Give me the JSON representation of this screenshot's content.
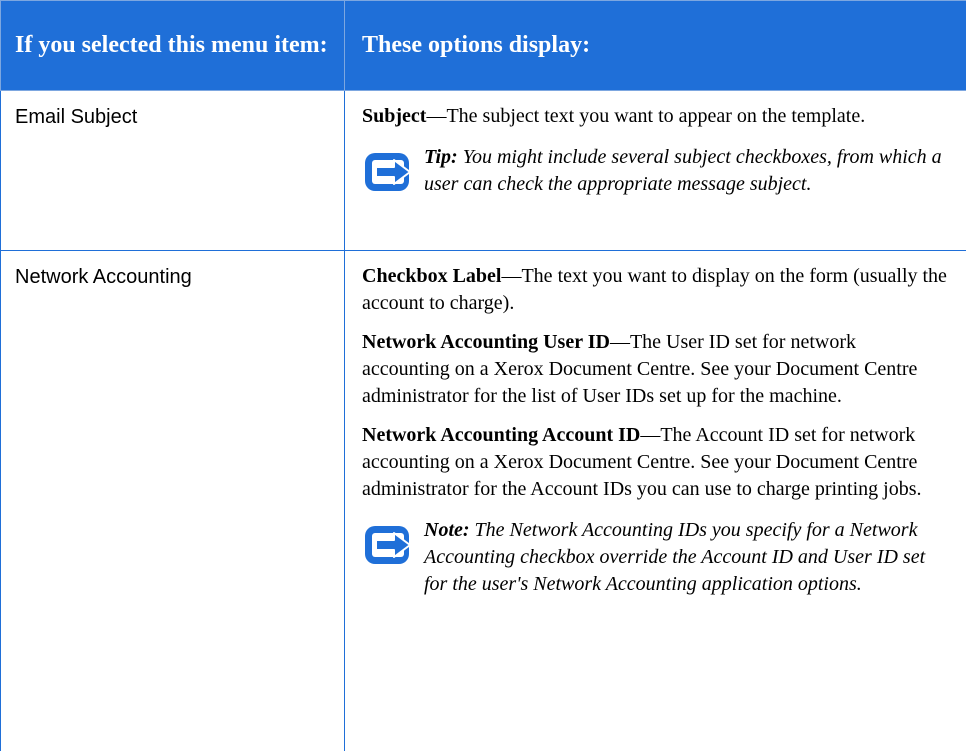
{
  "table": {
    "headers": [
      "If you selected this menu item:",
      "These options display:"
    ],
    "rows": [
      {
        "item": "Email Subject",
        "options": [
          {
            "term": "Subject",
            "text": "—The subject text you want to appear on the template."
          }
        ],
        "callout": {
          "label": "Tip:",
          "text": " You might include several subject checkboxes, from which a user can check the appropriate message subject."
        }
      },
      {
        "item": "Network Accounting",
        "options": [
          {
            "term": "Checkbox Label",
            "text": "—The text you want to display on the form (usually the account to charge)."
          },
          {
            "term": "Network Accounting User ID",
            "text": "—The User ID set for network accounting on a Xerox Document Centre.  See your Document Centre administrator for the list of User IDs set up for the machine."
          },
          {
            "term": "Network Accounting Account ID",
            "text": "—The Account ID set for network accounting on a Xerox Document Centre.  See your Document Centre administrator for the Account IDs you can use to charge printing jobs."
          }
        ],
        "callout": {
          "label": "Note:",
          "text": " The Network Accounting IDs you specify for a Network Accounting checkbox override the Account ID and User ID set for the user's Network Accounting application options."
        }
      }
    ]
  },
  "icon": "right-arrow-note-icon",
  "colors": {
    "header_bg": "#1f6fd8",
    "border": "#1f6fd8",
    "icon": "#1f6fd8"
  }
}
